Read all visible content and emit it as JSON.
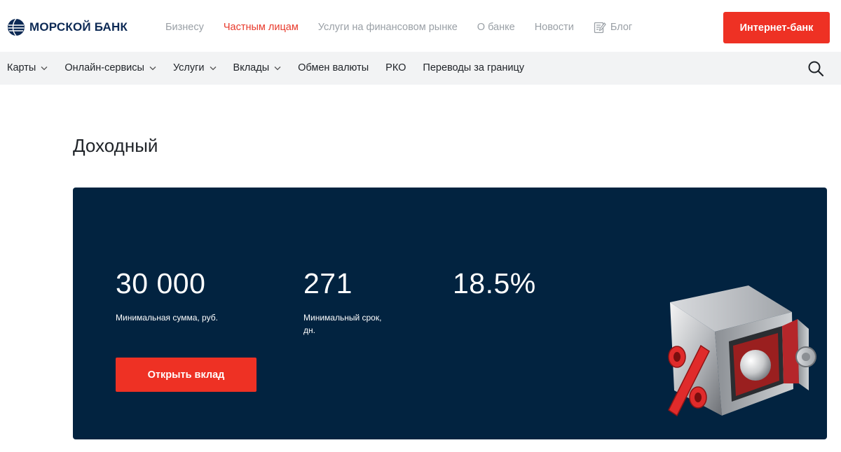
{
  "brand": {
    "name": "МОРСКОЙ БАНК",
    "primary_color": "#0d2a55",
    "accent_color": "#ee3124"
  },
  "topnav": {
    "items": [
      {
        "label": "Бизнесу",
        "active": false
      },
      {
        "label": "Частным лицам",
        "active": true
      },
      {
        "label": "Услуги на финансовом рынке",
        "active": false
      },
      {
        "label": "О банке",
        "active": false
      },
      {
        "label": "Новости",
        "active": false
      },
      {
        "label": "Блог",
        "active": false,
        "icon": "blog-edit-icon"
      }
    ],
    "internet_bank_label": "Интернет-банк"
  },
  "subnav": {
    "items": [
      {
        "label": "Карты",
        "dropdown": true
      },
      {
        "label": "Онлайн-сервисы",
        "dropdown": true
      },
      {
        "label": "Услуги",
        "dropdown": true
      },
      {
        "label": "Вклады",
        "dropdown": true
      },
      {
        "label": "Обмен валюты",
        "dropdown": false
      },
      {
        "label": "РКО",
        "dropdown": false
      },
      {
        "label": "Переводы за границу",
        "dropdown": false
      }
    ],
    "search_icon": "search-icon"
  },
  "page": {
    "title": "Доходный"
  },
  "hero": {
    "background": "#022340",
    "stats": [
      {
        "value": "30 000",
        "label": "Минимальная сумма, руб."
      },
      {
        "value": "271",
        "label": "Минимальный срок, дн."
      },
      {
        "value": "18.5%",
        "label": ""
      }
    ],
    "open_button_label": "Открыть вклад",
    "illustration": "safe-percent-illustration"
  }
}
